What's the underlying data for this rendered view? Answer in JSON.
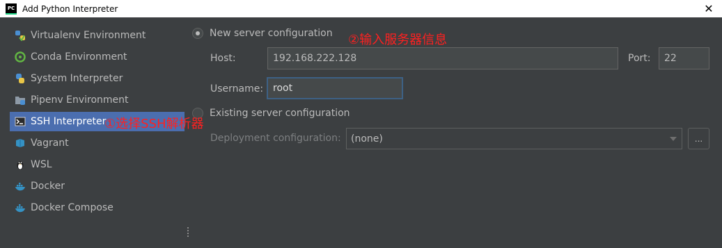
{
  "window": {
    "title": "Add Python Interpreter",
    "app_icon_text": "PC",
    "close_glyph": "✕"
  },
  "sidebar": {
    "items": [
      {
        "label": "Virtualenv Environment",
        "icon": "virtualenv-icon"
      },
      {
        "label": "Conda Environment",
        "icon": "conda-icon"
      },
      {
        "label": "System Interpreter",
        "icon": "python-icon"
      },
      {
        "label": "Pipenv Environment",
        "icon": "pipenv-icon"
      },
      {
        "label": "SSH Interpreter",
        "icon": "terminal-icon",
        "selected": true
      },
      {
        "label": "Vagrant",
        "icon": "vagrant-icon"
      },
      {
        "label": "WSL",
        "icon": "linux-penguin-icon"
      },
      {
        "label": "Docker",
        "icon": "docker-icon"
      },
      {
        "label": "Docker Compose",
        "icon": "docker-compose-icon"
      }
    ]
  },
  "form": {
    "new_config_label": "New server configuration",
    "new_config_selected": true,
    "host_label": "Host:",
    "host_value": "192.168.222.128",
    "port_label": "Port:",
    "port_value": "22",
    "username_label": "Username:",
    "username_value": "root",
    "existing_config_label": "Existing server configuration",
    "existing_config_selected": false,
    "deployment_label": "Deployment configuration:",
    "deployment_value": "(none)",
    "browse_button_label": "..."
  },
  "annotations": {
    "step1": "①选择SSH解析器",
    "step2": "②输入服务器信息"
  },
  "colors": {
    "background": "#3c3f41",
    "selection": "#4b6eaf",
    "annotation": "#ff2020",
    "focus_border": "#3d6185"
  }
}
